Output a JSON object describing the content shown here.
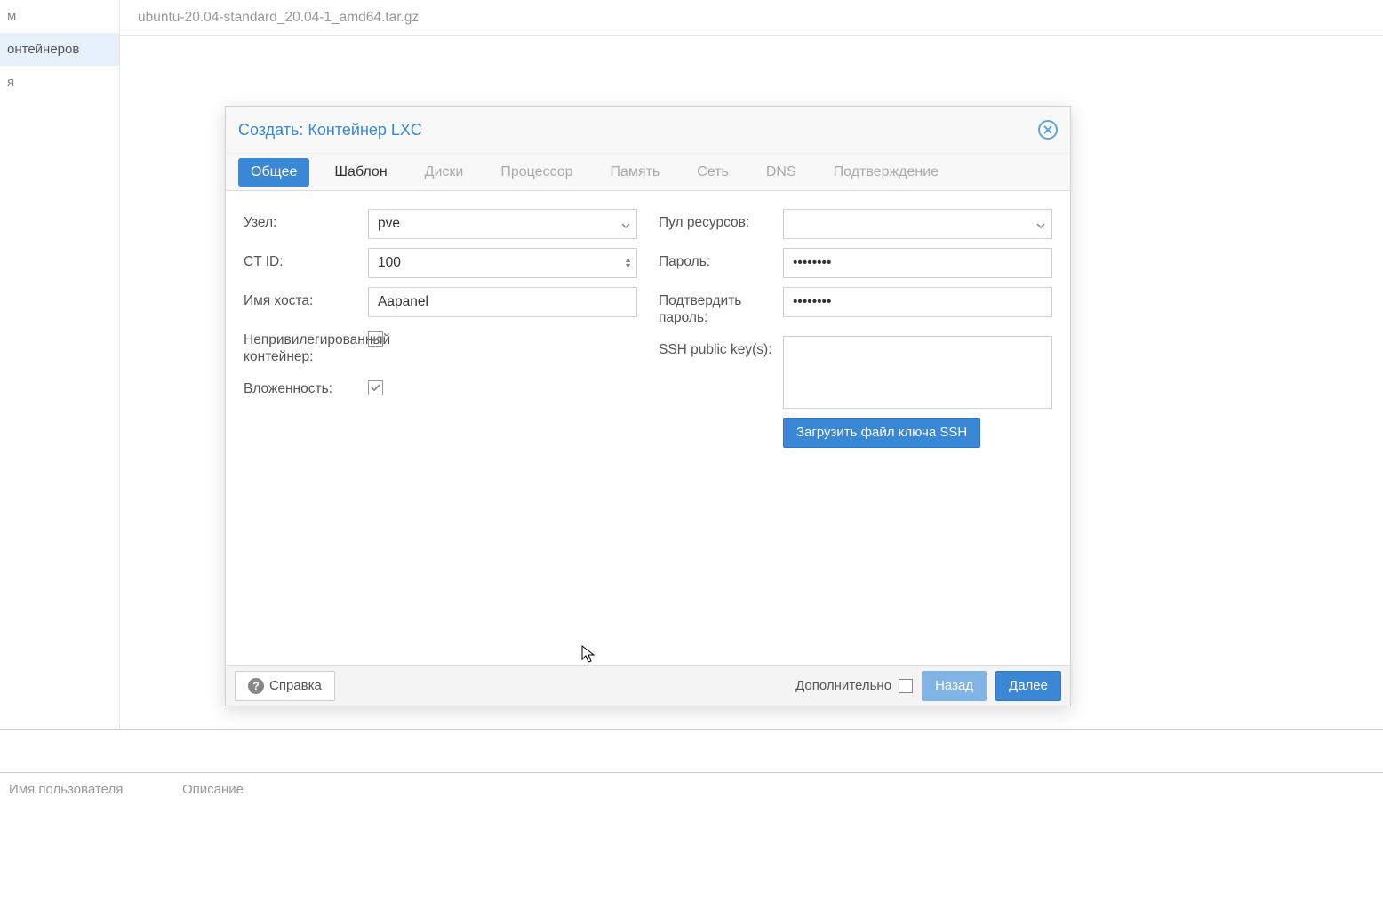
{
  "background": {
    "sidebar": [
      {
        "label": "м"
      },
      {
        "label": "онтейнеров",
        "selected": true
      },
      {
        "label": "я"
      }
    ],
    "content_header": "ubuntu-20.04-standard_20.04-1_amd64.tar.gz",
    "bottom_cols": [
      "Имя пользователя",
      "Описание"
    ]
  },
  "dialog": {
    "title": "Создать: Контейнер LXC",
    "tabs": [
      {
        "label": "Общее",
        "state": "current"
      },
      {
        "label": "Шаблон",
        "state": "enabled"
      },
      {
        "label": "Диски",
        "state": "disabled"
      },
      {
        "label": "Процессор",
        "state": "disabled"
      },
      {
        "label": "Память",
        "state": "disabled"
      },
      {
        "label": "Сеть",
        "state": "disabled"
      },
      {
        "label": "DNS",
        "state": "disabled"
      },
      {
        "label": "Подтверждение",
        "state": "disabled"
      }
    ],
    "left": {
      "node_label": "Узел:",
      "node_value": "pve",
      "ctid_label": "CT ID:",
      "ctid_value": "100",
      "hostname_label": "Имя хоста:",
      "hostname_value": "Aapanel",
      "unpriv_label": "Непривилегированный контейнер:",
      "unpriv_checked": true,
      "nested_label": "Вложенность:",
      "nested_checked": true
    },
    "right": {
      "pool_label": "Пул ресурсов:",
      "pool_value": "",
      "password_label": "Пароль:",
      "password_value": "••••••••",
      "confirm_label": "Подтвердить пароль:",
      "confirm_value": "••••••••",
      "ssh_label": "SSH public key(s):",
      "ssh_value": "",
      "ssh_upload": "Загрузить файл ключа SSH"
    },
    "footer": {
      "help": "Справка",
      "advanced": "Дополнительно",
      "advanced_checked": false,
      "back": "Назад",
      "next": "Далее"
    }
  }
}
